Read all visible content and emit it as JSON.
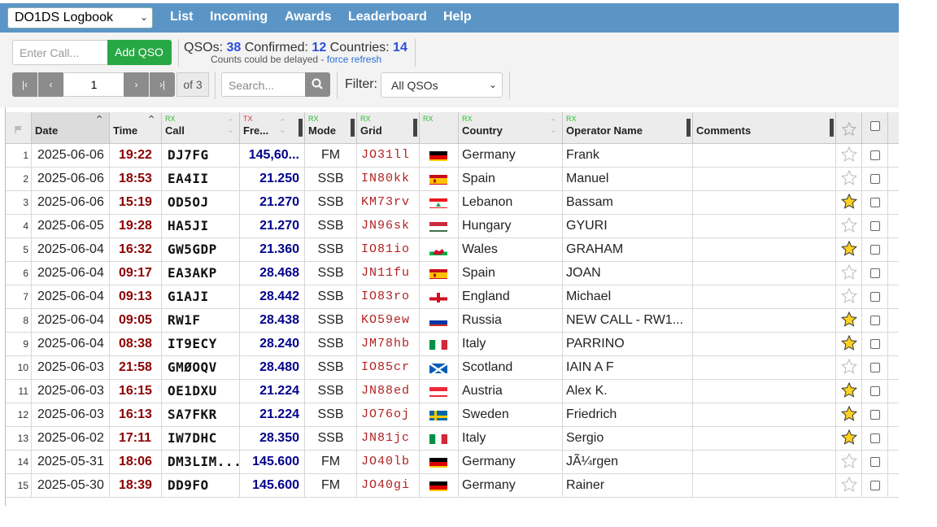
{
  "nav": {
    "logbook": "DO1DS Logbook",
    "links": [
      "List",
      "Incoming",
      "Awards",
      "Leaderboard",
      "Help"
    ]
  },
  "toolbar": {
    "call_placeholder": "Enter Call...",
    "add_label": "Add QSO",
    "qsos_label": "QSOs:",
    "qsos": "38",
    "confirmed_label": "Confirmed:",
    "confirmed": "12",
    "countries_label": "Countries:",
    "countries": "14",
    "delay_text": "Counts could be delayed - ",
    "refresh_link": "force refresh",
    "page": "1",
    "page_of": "of 3",
    "search_placeholder": "Search...",
    "filter_label": "Filter:",
    "filter_value": "All QSOs"
  },
  "table": {
    "headers": {
      "date": "Date",
      "time": "Time",
      "call": "Call",
      "freq": "Fre...",
      "mode": "Mode",
      "grid": "Grid",
      "country": "Country",
      "op": "Operator Name",
      "comments": "Comments",
      "rx": "RX",
      "tx": "TX"
    },
    "rows": [
      {
        "n": "1",
        "date": "2025-06-06",
        "time": "19:22",
        "call": "DJ7FG",
        "freq": "145,60...",
        "mode": "FM",
        "grid": "JO31ll",
        "flag": "de",
        "country": "Germany",
        "op": "Frank",
        "star": false
      },
      {
        "n": "2",
        "date": "2025-06-06",
        "time": "18:53",
        "call": "EA4II",
        "freq": "21.250",
        "mode": "SSB",
        "grid": "IN80kk",
        "flag": "es",
        "country": "Spain",
        "op": "Manuel",
        "star": false
      },
      {
        "n": "3",
        "date": "2025-06-06",
        "time": "15:19",
        "call": "OD5OJ",
        "freq": "21.270",
        "mode": "SSB",
        "grid": "KM73rv",
        "flag": "lb",
        "country": "Lebanon",
        "op": "Bassam",
        "star": true
      },
      {
        "n": "4",
        "date": "2025-06-05",
        "time": "19:28",
        "call": "HA5JI",
        "freq": "21.270",
        "mode": "SSB",
        "grid": "JN96sk",
        "flag": "hu",
        "country": "Hungary",
        "op": "GYURI",
        "star": false
      },
      {
        "n": "5",
        "date": "2025-06-04",
        "time": "16:32",
        "call": "GW5GDP",
        "freq": "21.360",
        "mode": "SSB",
        "grid": "IO81io",
        "flag": "wales",
        "country": "Wales",
        "op": "GRAHAM",
        "star": true
      },
      {
        "n": "6",
        "date": "2025-06-04",
        "time": "09:17",
        "call": "EA3AKP",
        "freq": "28.468",
        "mode": "SSB",
        "grid": "JN11fu",
        "flag": "es",
        "country": "Spain",
        "op": "JOAN",
        "star": false
      },
      {
        "n": "7",
        "date": "2025-06-04",
        "time": "09:13",
        "call": "G1AJI",
        "freq": "28.442",
        "mode": "SSB",
        "grid": "IO83ro",
        "flag": "en",
        "country": "England",
        "op": "Michael",
        "star": false
      },
      {
        "n": "8",
        "date": "2025-06-04",
        "time": "09:05",
        "call": "RW1F",
        "freq": "28.438",
        "mode": "SSB",
        "grid": "KO59ew",
        "flag": "ru",
        "country": "Russia",
        "op": "NEW CALL - RW1...",
        "star": true
      },
      {
        "n": "9",
        "date": "2025-06-04",
        "time": "08:38",
        "call": "IT9ECY",
        "freq": "28.240",
        "mode": "SSB",
        "grid": "JM78hb",
        "flag": "it",
        "country": "Italy",
        "op": "PARRINO",
        "star": true
      },
      {
        "n": "10",
        "date": "2025-06-03",
        "time": "21:58",
        "call": "GMØOQV",
        "freq": "28.480",
        "mode": "SSB",
        "grid": "IO85cr",
        "flag": "sc",
        "country": "Scotland",
        "op": "IAIN A F",
        "star": false
      },
      {
        "n": "11",
        "date": "2025-06-03",
        "time": "16:15",
        "call": "OE1DXU",
        "freq": "21.224",
        "mode": "SSB",
        "grid": "JN88ed",
        "flag": "at",
        "country": "Austria",
        "op": "Alex K.",
        "star": true
      },
      {
        "n": "12",
        "date": "2025-06-03",
        "time": "16:13",
        "call": "SA7FKR",
        "freq": "21.224",
        "mode": "SSB",
        "grid": "JO76oj",
        "flag": "se",
        "country": "Sweden",
        "op": "Friedrich",
        "star": true
      },
      {
        "n": "13",
        "date": "2025-06-02",
        "time": "17:11",
        "call": "IW7DHC",
        "freq": "28.350",
        "mode": "SSB",
        "grid": "JN81jc",
        "flag": "it",
        "country": "Italy",
        "op": "Sergio",
        "star": true
      },
      {
        "n": "14",
        "date": "2025-05-31",
        "time": "18:06",
        "call": "DM3LIM...",
        "freq": "145.600",
        "mode": "FM",
        "grid": "JO40lb",
        "flag": "de",
        "country": "Germany",
        "op": "JÃ¼rgen",
        "star": false
      },
      {
        "n": "15",
        "date": "2025-05-30",
        "time": "18:39",
        "call": "DD9FO",
        "freq": "145.600",
        "mode": "FM",
        "grid": "JO40gi",
        "flag": "de",
        "country": "Germany",
        "op": "Rainer",
        "star": false
      }
    ]
  }
}
